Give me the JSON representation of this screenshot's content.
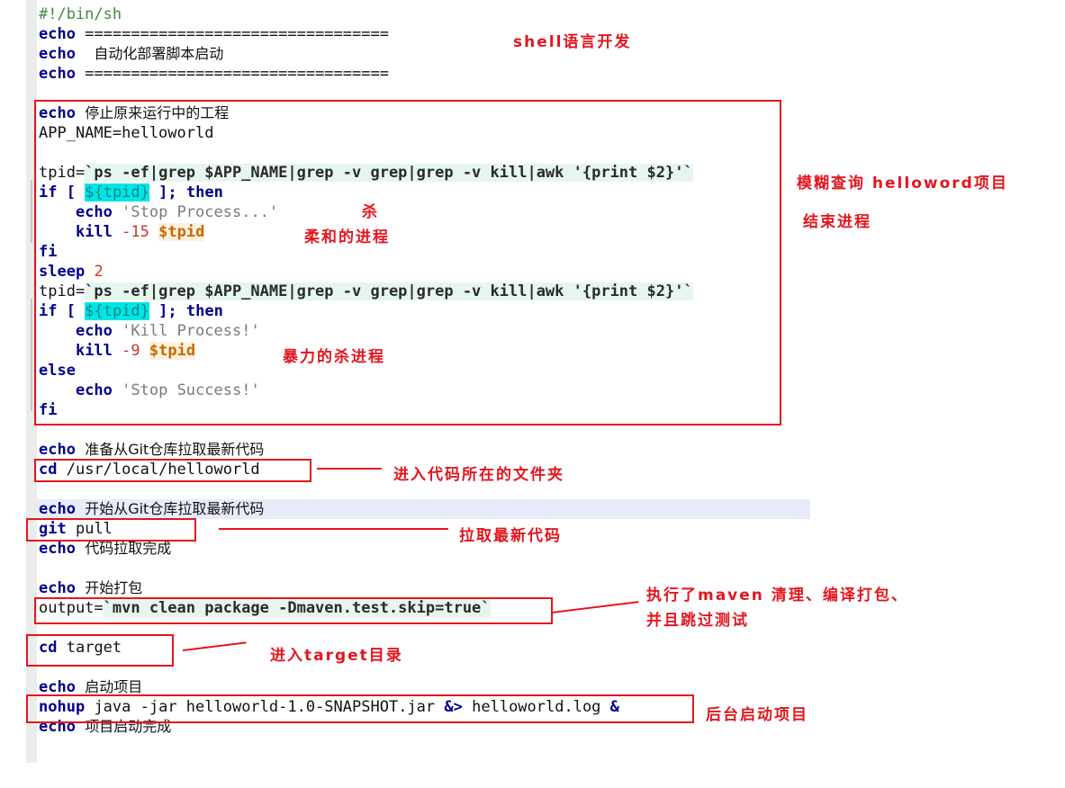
{
  "code": {
    "shebang": "#!/bin/sh",
    "echo_kw": "echo",
    "separator": "=================================",
    "start_msg": "  自动化部署脚本启动",
    "stop_msg": "停止原来运行中的工程",
    "app_name_line": "APP_NAME=helloworld",
    "tpid_assign": "tpid=",
    "tpid_cmd": "`ps -ef|grep $APP_NAME|grep -v grep|grep -v kill|awk '{print $2}'`",
    "if_kw": "if",
    "bracket_open": "[",
    "tpid_expand": "${tpid}",
    "bracket_close": "];",
    "then_kw": "then",
    "stop_process_str": "'Stop Process...'",
    "kill_kw": "kill",
    "sig15": "-15",
    "sig9": "-9",
    "tpid_var": "$tpid",
    "fi_kw": "fi",
    "sleep_kw": "sleep",
    "sleep_val": "2",
    "kill_process_str": "'Kill Process!'",
    "else_kw": "else",
    "stop_success_str": "'Stop Success!'",
    "prep_msg": "准备从Git仓库拉取最新代码",
    "cd_kw": "cd",
    "cd_path": "/usr/local/helloworld",
    "pull_msg": "开始从Git仓库拉取最新代码",
    "git_kw": "git",
    "pull_arg": "pull",
    "pull_done_msg": "代码拉取完成",
    "pack_msg": "开始打包",
    "output_assign": "output=",
    "mvn_cmd": "`mvn clean package -Dmaven.test.skip=true`",
    "target_arg": "target",
    "launch_msg": "启动项目",
    "nohup_kw": "nohup",
    "java_cmd": "java -jar helloworld-1.0-SNAPSHOT.jar",
    "redirect": "&>",
    "log_file": "helloworld.log",
    "bg_amp": "&",
    "launch_done_msg": "项目启动完成"
  },
  "annotations": {
    "shell_dev": "shell语言开发",
    "fuzzy_query": "模糊查询 helloword项目",
    "end_process": "结束进程",
    "kill_char": "杀",
    "gentle_kill": "柔和的进程",
    "force_kill": "暴力的杀进程",
    "enter_code_dir": "进入代码所在的文件夹",
    "pull_latest": "拉取最新代码",
    "maven_line1": "执行了maven 清理、编译打包、",
    "maven_line2": "并且跳过测试",
    "enter_target": "进入target目录",
    "bg_launch": "后台启动项目"
  }
}
